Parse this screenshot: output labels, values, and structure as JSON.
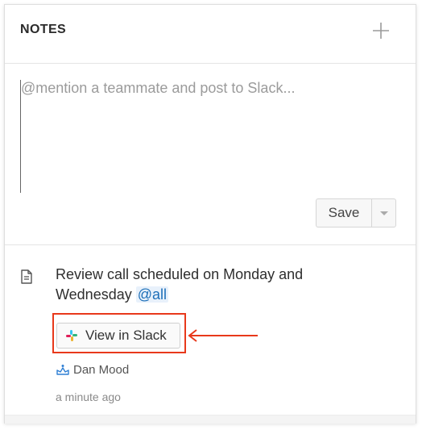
{
  "header": {
    "title": "NOTES",
    "add_icon": "plus-icon"
  },
  "composer": {
    "placeholder": "@mention a teammate and post to Slack...",
    "value": "",
    "save_label": "Save",
    "dropdown_icon": "caret-down-icon"
  },
  "note": {
    "icon": "document-icon",
    "text": "Review call scheduled on Monday and Wednesday",
    "mention": "@all",
    "slack_button_label": "View in Slack",
    "slack_icon": "slack-icon",
    "author_icon": "crown-icon",
    "author": "Dan Mood",
    "timestamp": "a minute ago"
  },
  "colors": {
    "highlight": "#e8391b",
    "mention": "#1d6fb8"
  }
}
